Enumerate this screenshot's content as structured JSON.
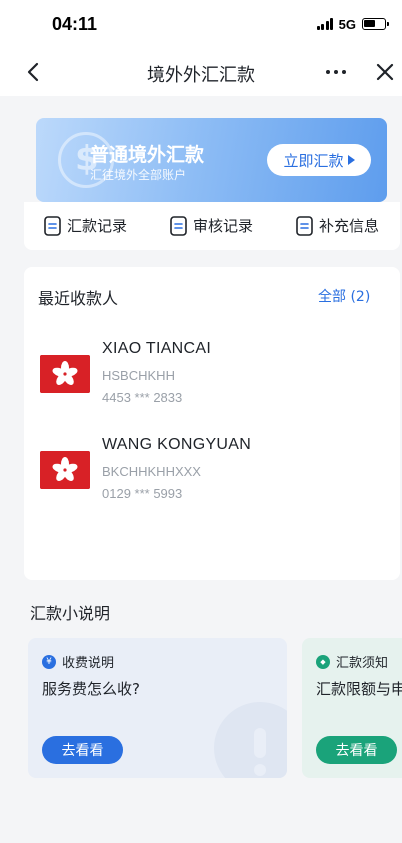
{
  "status_bar": {
    "time": "04:11",
    "network": "5G"
  },
  "nav": {
    "title": "境外外汇汇款"
  },
  "banner": {
    "title": "普通境外汇款",
    "subtitle": "汇往境外全部账户",
    "button_label": "立即汇款"
  },
  "quick_links": [
    {
      "label": "汇款记录"
    },
    {
      "label": "审核记录"
    },
    {
      "label": "补充信息"
    }
  ],
  "recent": {
    "title": "最近收款人",
    "view_all": "全部 (2)",
    "recipients": [
      {
        "name": "XIAO TIANCAI",
        "bank_code": "HSBCHKHH",
        "account": "4453 *** 2833"
      },
      {
        "name": "WANG KONGYUAN",
        "bank_code": "BKCHHKHHXXX",
        "account": "0129 *** 5993"
      }
    ]
  },
  "guide": {
    "title": "汇款小说明",
    "cards": [
      {
        "badge": "¥",
        "heading": "收费说明",
        "question": "服务费怎么收?",
        "button_label": "去看看"
      },
      {
        "badge": "◆",
        "heading": "汇款须知",
        "question": "汇款限额与申",
        "button_label": "去看看"
      }
    ]
  },
  "colors": {
    "accent_blue": "#2a6fe0",
    "primary_button": "#2a6fe0",
    "secondary_button": "#1aa37a",
    "flag_red": "#d82126"
  }
}
